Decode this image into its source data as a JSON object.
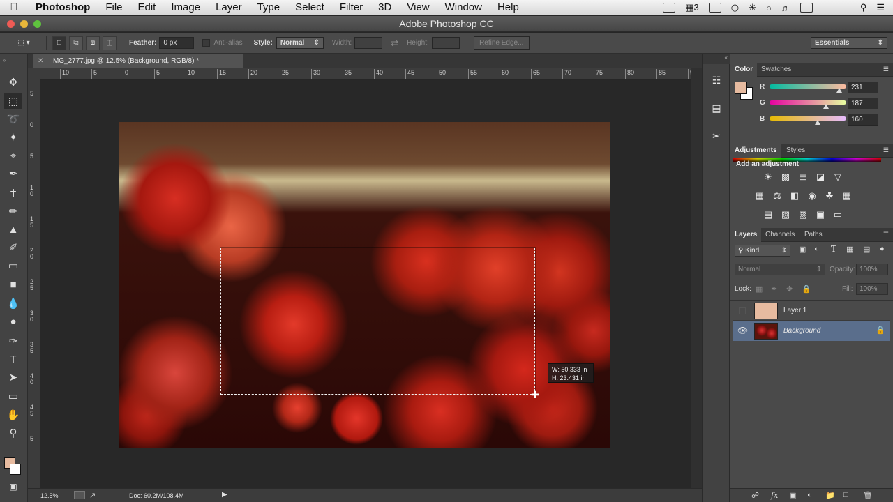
{
  "menubar": {
    "app": "Photoshop",
    "items": [
      "File",
      "Edit",
      "Image",
      "Layer",
      "Type",
      "Select",
      "Filter",
      "3D",
      "View",
      "Window",
      "Help"
    ],
    "status_badge": "3"
  },
  "window": {
    "title": "Adobe Photoshop CC"
  },
  "options_bar": {
    "feather_label": "Feather:",
    "feather_value": "0 px",
    "antialias_label": "Anti-alias",
    "style_label": "Style:",
    "style_value": "Normal",
    "width_label": "Width:",
    "height_label": "Height:",
    "refine_edge": "Refine Edge...",
    "workspace": "Essentials"
  },
  "document": {
    "tab_title": "IMG_2777.jpg @ 12.5% (Background, RGB/8) *",
    "ruler_h_labels": [
      "10",
      "5",
      "0",
      "5",
      "10",
      "15",
      "20",
      "25",
      "30",
      "35",
      "40",
      "45",
      "50",
      "55",
      "60",
      "65",
      "70",
      "75",
      "80",
      "85",
      "9"
    ],
    "ruler_v_labels": [
      "5",
      "0",
      "5",
      "1 0",
      "1 5",
      "2 0",
      "2 5",
      "3 0",
      "3 5",
      "4 0",
      "4 5",
      "5"
    ],
    "readout_w": "W: 50.333 in",
    "readout_h": "H: 23.431 in"
  },
  "statusbar": {
    "zoom": "12.5%",
    "doc": "Doc: 60.2M/108.4M"
  },
  "color_panel": {
    "tabs": [
      "Color",
      "Swatches"
    ],
    "channels": [
      {
        "label": "R",
        "value": "231",
        "fraction": 0.906
      },
      {
        "label": "G",
        "value": "187",
        "fraction": 0.733
      },
      {
        "label": "B",
        "value": "160",
        "fraction": 0.627
      }
    ],
    "foreground": "#e7bba0"
  },
  "adjustments_panel": {
    "tabs": [
      "Adjustments",
      "Styles"
    ],
    "heading": "Add an adjustment"
  },
  "layers_panel": {
    "tabs": [
      "Layers",
      "Channels",
      "Paths"
    ],
    "kind": "Kind",
    "blend_mode": "Normal",
    "opacity_label": "Opacity:",
    "opacity_value": "100%",
    "lock_label": "Lock:",
    "fill_label": "Fill:",
    "fill_value": "100%",
    "layers": [
      {
        "name": "Layer 1",
        "visible": false,
        "selected": false
      },
      {
        "name": "Background",
        "visible": true,
        "selected": true
      }
    ]
  },
  "colors": {
    "selected_layer": "#5a6e8c",
    "accent": "#e7bba0"
  }
}
